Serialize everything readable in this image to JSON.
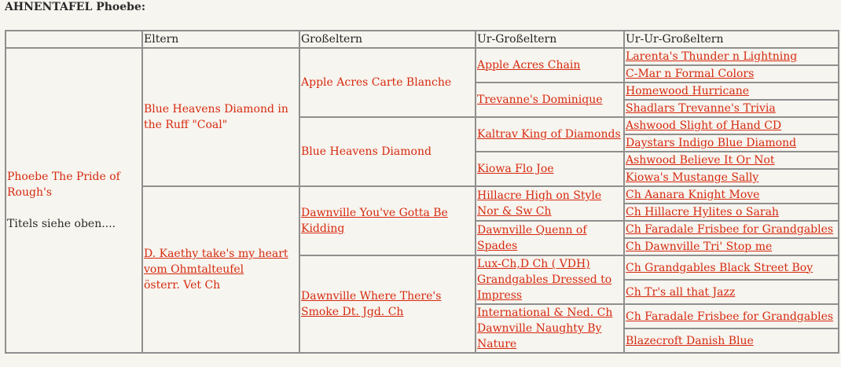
{
  "title": "AHNENTAFEL Phoebe:",
  "headers": [
    "",
    "Eltern",
    "Großeltern",
    "Ur-Großeltern",
    "Ur-Ur-Großeltern"
  ],
  "subject": {
    "name": "Phoebe The Pride of Rough's",
    "note": "Titels  siehe oben...."
  },
  "parents": [
    {
      "name": "Blue Heavens Diamond in the Ruff \"Coal\""
    },
    {
      "name": "D. Kaethy take's my heart vom Ohmtalteufel",
      "title": "österr. Vet Ch"
    }
  ],
  "grandparents": [
    "Apple Acres Carte Blanche",
    "Blue Heavens Diamond",
    "Dawnville You've Gotta Be Kidding ",
    "Dawnville Where There's Smoke Dt. Jgd. Ch"
  ],
  "great_grandparents": [
    "Apple Acres Chain",
    "Trevanne's Dominique",
    "Kaltrav King of Diamonds",
    "Kiowa Flo Joe",
    "Hillacre High on Style Nor & Sw Ch",
    "Dawnville Quenn of Spades",
    "Lux-Ch,D Ch ( VDH) Grandgables Dressed to Impress",
    "International & Ned. Ch Dawnville Naughty By Nature"
  ],
  "great_great_grandparents": [
    "Larenta's Thunder n Lightning",
    "C-Mar n Formal Colors",
    "Homewood Hurricane",
    "Shadlars Trevanne's Trivia",
    "Ashwood Slight of Hand CD",
    "Daystars Indigo Blue Diamond",
    "Ashwood Believe It Or Not",
    "Kiowa's Mustange Sally",
    "Ch Aanara Knight Move",
    "Ch Hillacre Hylites o Sarah",
    "Ch Faradale Frisbee for Grandgables",
    "Ch Dawnville Tri' Stop me",
    "Ch Grandgables Black Street Boy",
    "Ch Tr's all that Jazz",
    "Ch Faradale Frisbee for Grandgables",
    "Blazecroft Danish Blue"
  ],
  "colors": {
    "link": "#d62a10",
    "border": "#8f8f8f",
    "background": "#f7f5ef"
  }
}
